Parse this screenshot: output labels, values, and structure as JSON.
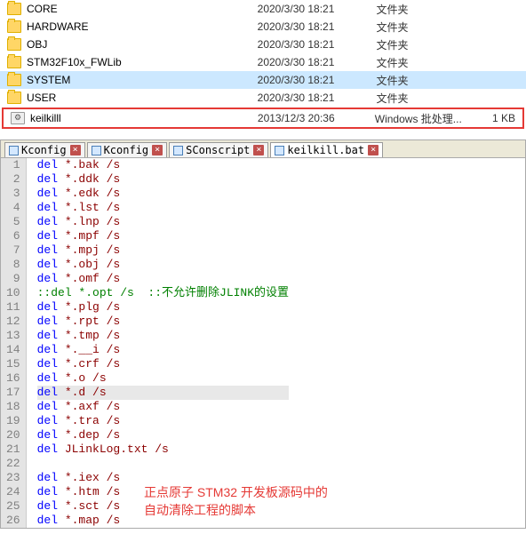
{
  "file_list": [
    {
      "name": "CORE",
      "date": "2020/3/30 18:21",
      "type": "文件夹",
      "size": "",
      "icon": "folder"
    },
    {
      "name": "HARDWARE",
      "date": "2020/3/30 18:21",
      "type": "文件夹",
      "size": "",
      "icon": "folder"
    },
    {
      "name": "OBJ",
      "date": "2020/3/30 18:21",
      "type": "文件夹",
      "size": "",
      "icon": "folder"
    },
    {
      "name": "STM32F10x_FWLib",
      "date": "2020/3/30 18:21",
      "type": "文件夹",
      "size": "",
      "icon": "folder"
    },
    {
      "name": "SYSTEM",
      "date": "2020/3/30 18:21",
      "type": "文件夹",
      "size": "",
      "icon": "folder",
      "selected": true
    },
    {
      "name": "USER",
      "date": "2020/3/30 18:21",
      "type": "文件夹",
      "size": "",
      "icon": "folder"
    }
  ],
  "highlighted_file": {
    "name": "keilkilll",
    "date": "2013/12/3 20:36",
    "type": "Windows 批处理...",
    "size": "1 KB",
    "icon": "bat"
  },
  "tabs": [
    {
      "label": "Kconfig"
    },
    {
      "label": "Kconfig"
    },
    {
      "label": "SConscript"
    },
    {
      "label": "keilkill.bat",
      "active": true
    }
  ],
  "code_lines": [
    {
      "n": 1,
      "cmd": "del",
      "arg": "*.bak /s"
    },
    {
      "n": 2,
      "cmd": "del",
      "arg": "*.ddk /s"
    },
    {
      "n": 3,
      "cmd": "del",
      "arg": "*.edk /s"
    },
    {
      "n": 4,
      "cmd": "del",
      "arg": "*.lst /s"
    },
    {
      "n": 5,
      "cmd": "del",
      "arg": "*.lnp /s"
    },
    {
      "n": 6,
      "cmd": "del",
      "arg": "*.mpf /s"
    },
    {
      "n": 7,
      "cmd": "del",
      "arg": "*.mpj /s"
    },
    {
      "n": 8,
      "cmd": "del",
      "arg": "*.obj /s"
    },
    {
      "n": 9,
      "cmd": "del",
      "arg": "*.omf /s"
    },
    {
      "n": 10,
      "comment": "::del *.opt /s  ::不允许删除JLINK的设置"
    },
    {
      "n": 11,
      "cmd": "del",
      "arg": "*.plg /s"
    },
    {
      "n": 12,
      "cmd": "del",
      "arg": "*.rpt /s"
    },
    {
      "n": 13,
      "cmd": "del",
      "arg": "*.tmp /s"
    },
    {
      "n": 14,
      "cmd": "del",
      "arg": "*.__i /s"
    },
    {
      "n": 15,
      "cmd": "del",
      "arg": "*.crf /s"
    },
    {
      "n": 16,
      "cmd": "del",
      "arg": "*.o /s"
    },
    {
      "n": 17,
      "cmd": "del",
      "arg": "*.d /s",
      "current": true
    },
    {
      "n": 18,
      "cmd": "del",
      "arg": "*.axf /s"
    },
    {
      "n": 19,
      "cmd": "del",
      "arg": "*.tra /s"
    },
    {
      "n": 20,
      "cmd": "del",
      "arg": "*.dep /s"
    },
    {
      "n": 21,
      "cmd": "del",
      "arg": "JLinkLog.txt /s"
    },
    {
      "n": 22,
      "blank": true
    },
    {
      "n": 23,
      "cmd": "del",
      "arg": "*.iex /s"
    },
    {
      "n": 24,
      "cmd": "del",
      "arg": "*.htm /s"
    },
    {
      "n": 25,
      "cmd": "del",
      "arg": "*.sct /s"
    },
    {
      "n": 26,
      "cmd": "del",
      "arg": "*.map /s"
    }
  ],
  "annotation": {
    "l1": "正点原子 STM32 开发板源码中的",
    "l2": "自动清除工程的脚本"
  }
}
